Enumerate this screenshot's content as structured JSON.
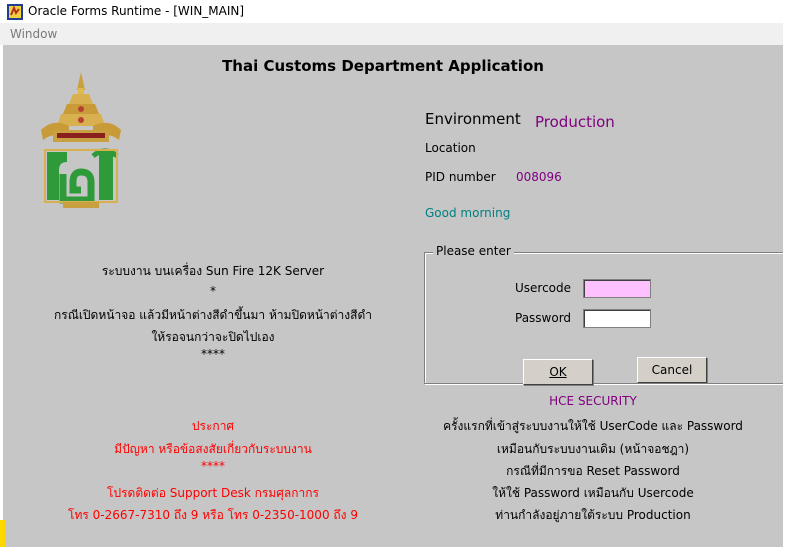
{
  "window": {
    "title": "Oracle Forms Runtime - [WIN_MAIN]",
    "menu": [
      "Window"
    ]
  },
  "header": {
    "title": "Thai Customs Department Application"
  },
  "info": {
    "environment_label": "Environment",
    "environment_value": "Production",
    "location_label": "Location",
    "pid_label": "PID number",
    "pid_value": "008096",
    "greeting": "Good morning"
  },
  "login": {
    "group_title": "Please enter",
    "usercode_label": "Usercode",
    "usercode_value": "",
    "password_label": "Password",
    "password_value": "",
    "ok_label": "OK",
    "cancel_label": "Cancel"
  },
  "notice": {
    "lines": [
      "ระบบงาน บนเครื่อง Sun Fire 12K Server",
      "*",
      "กรณีเปิดหน้าจอ แล้วมีหน้าต่างสีดำขึ้นมา  ห้ามปิดหน้าต่างสีดำ",
      "ให้รอจนกว่าจะปิดไปเอง",
      "****"
    ]
  },
  "announcement": {
    "lines": [
      "ประกาศ",
      "มีปัญหา หรือข้อสงสัยเกี่ยวกับระบบงาน",
      "****",
      "โปรดติดต่อ Support Desk กรมศุลกากร",
      "โทร 0-2667-7310 ถึง 9 หรือ โทร 0-2350-1000 ถึง 9"
    ]
  },
  "security": {
    "title": "HCE SECURITY",
    "lines": [
      "ครั้งแรกที่เข้าสู่ระบบงานให้ใช้ UserCode และ Password",
      "เหมือนกับระบบงานเดิม (หน้าจอชฎา)",
      "กรณีที่มีการขอ Reset Password",
      "ให้ใช้ Password เหมือนกับ  Usercode",
      "ท่านกำลังอยู่ภายใต้ระบบ Production"
    ]
  },
  "colors": {
    "background": "#c6c6c6",
    "environment_value": "#800080",
    "greeting": "#008080",
    "announcement": "#ff0000",
    "usercode_field": "#ffc0ff"
  }
}
